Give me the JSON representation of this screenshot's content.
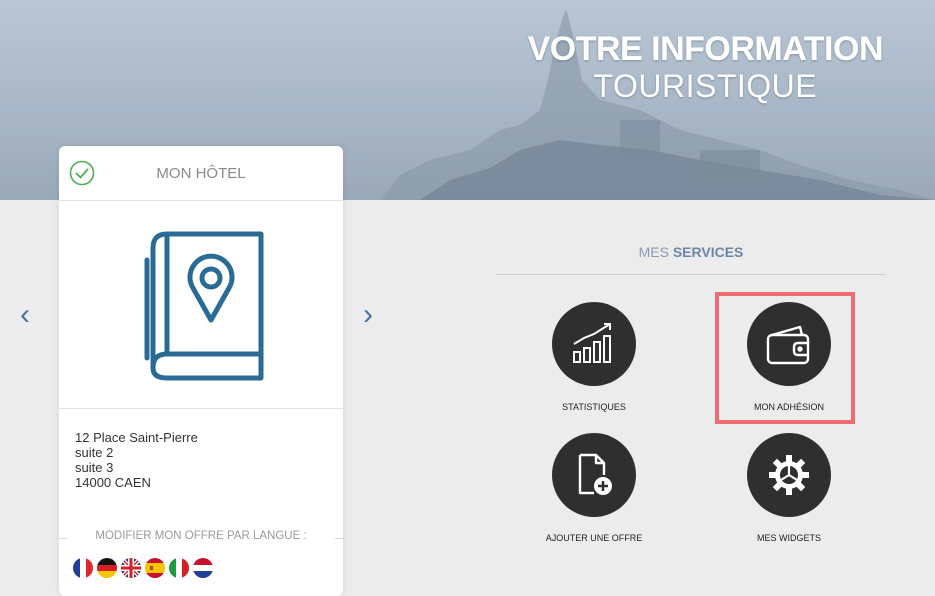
{
  "hero": {
    "title_line1": "VOTRE INFORMATION",
    "title_line2": "TOURISTIQUE"
  },
  "card": {
    "title": "MON HÔTEL",
    "address": [
      "12 Place Saint-Pierre",
      "suite 2",
      "suite 3",
      "14000 CAEN"
    ],
    "lang_label": "MODIFIER MON OFFRE PAR LANGUE :",
    "flags": [
      "fr",
      "de",
      "gb",
      "es",
      "it",
      "nl"
    ]
  },
  "nav": {
    "prev": "‹",
    "next": "›"
  },
  "services": {
    "title_prefix": "MES",
    "title_bold": "SERVICES",
    "items": [
      {
        "label": "STATISTIQUES",
        "icon": "statistics-chart-icon"
      },
      {
        "label": "MON ADHÉSION",
        "icon": "wallet-icon"
      },
      {
        "label": "AJOUTER UNE OFFRE",
        "icon": "add-document-icon"
      },
      {
        "label": "MES WIDGETS",
        "icon": "gear-widget-icon"
      }
    ]
  },
  "colors": {
    "accent_blue": "#2a6b96",
    "highlight": "#f06c73",
    "service_circle": "#2f2f2f"
  }
}
